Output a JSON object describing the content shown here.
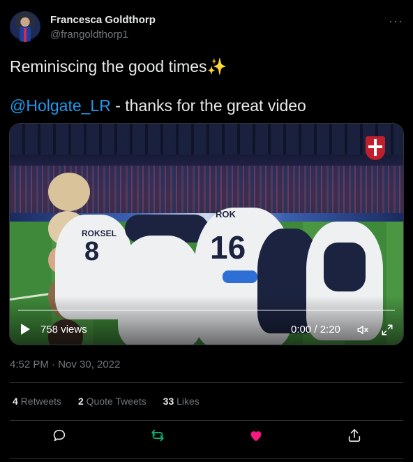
{
  "author": {
    "name": "Francesca Goldthorp",
    "handle": "@frangoldthorp1"
  },
  "more_label": "···",
  "tweet": {
    "line1": "Reminiscing the good times✨",
    "mention": "@Holgate_LR",
    "line2_rest": " - thanks for the great video"
  },
  "video": {
    "views": "758 views",
    "time": "0:00 / 2:20",
    "jersey_numbers": [
      "8",
      "16"
    ],
    "jersey_names": [
      "ROKSEL",
      "ROK"
    ]
  },
  "timestamp": "4:52 PM · Nov 30, 2022",
  "stats": {
    "retweets_count": "4",
    "retweets_label": "Retweets",
    "quotes_count": "2",
    "quotes_label": "Quote Tweets",
    "likes_count": "33",
    "likes_label": "Likes"
  },
  "colors": {
    "link": "#1d9bf0",
    "retweet_active": "#00ba7c",
    "like_active": "#f91880",
    "muted": "#71767b"
  },
  "icons": [
    "reply-icon",
    "retweet-icon",
    "like-icon",
    "share-icon",
    "play-icon",
    "volume-icon",
    "expand-icon",
    "more-icon"
  ]
}
